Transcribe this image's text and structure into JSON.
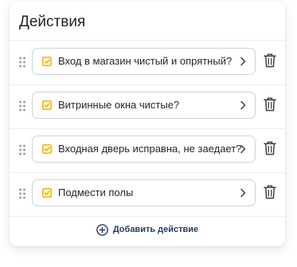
{
  "panel": {
    "title": "Действия",
    "add_label": "Добавить действие"
  },
  "actions": [
    {
      "label": "Вход в магазин чистый и опрятный?"
    },
    {
      "label": "Витринные окна чистые?"
    },
    {
      "label": "Входная дверь исправна, не заедает?"
    },
    {
      "label": "Подмести полы"
    }
  ],
  "colors": {
    "checkbox": "#f2b705",
    "accent": "#233d63"
  },
  "icons": {
    "drag": "drag-handle-icon",
    "item": "checkbox-icon",
    "open": "chevron-right-icon",
    "delete": "trash-icon",
    "add": "plus-circle-icon"
  }
}
